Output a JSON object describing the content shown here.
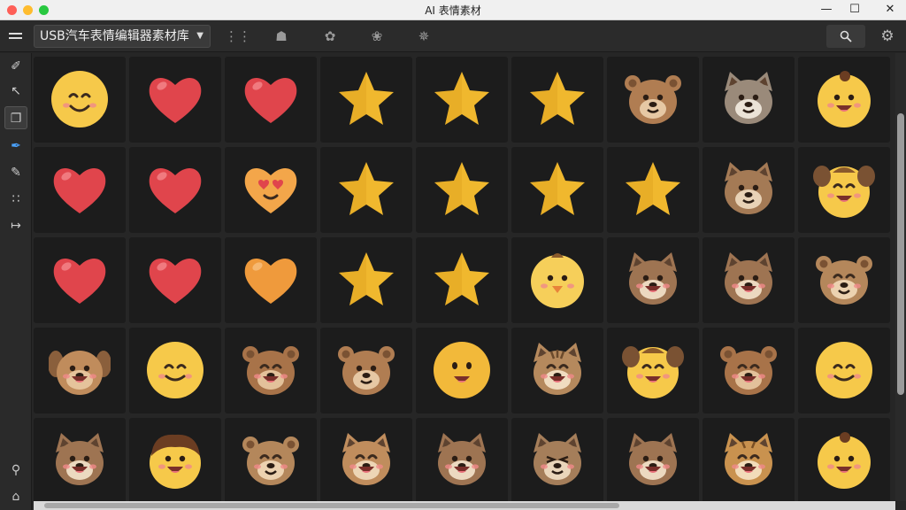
{
  "window": {
    "title": "AI 表情素材"
  },
  "toolbar": {
    "library_select": "USB汽车表情编辑器素材库",
    "tools": [
      "grid-icon",
      "bag-icon",
      "sprout-icon",
      "leaf-icon",
      "sparkle-icon"
    ],
    "search_icon": "search-icon",
    "settings_icon": "gear-icon"
  },
  "sidebar": {
    "tools": [
      "brush-icon",
      "cursor-icon",
      "new-frame-icon",
      "pen-icon",
      "pencil-icon",
      "scatter-icon",
      "crop-icon"
    ],
    "bottom": [
      "user-search-icon",
      "home-icon"
    ],
    "active_index": 2
  },
  "colors": {
    "heart": "#e0454c",
    "heart_highlight": "#f07a7f",
    "star": "#f0b82e",
    "star_shade": "#d99a1a",
    "smiley": "#f6c94a",
    "bear": "#b07d52",
    "cat": "#9a8a7a",
    "orange_heart": "#ef9a3c"
  },
  "grid": {
    "columns": 9,
    "rows": [
      [
        "smiley",
        "heart",
        "heart",
        "star",
        "star",
        "star",
        "bear",
        "wolf",
        "baby"
      ],
      [
        "heart",
        "heart",
        "heart-eyes",
        "star",
        "star",
        "star",
        "star",
        "fox",
        "puppy-smiley"
      ],
      [
        "heart",
        "heart",
        "orange-heart",
        "star",
        "star",
        "chick",
        "dog",
        "dog",
        "bear-squint"
      ],
      [
        "puppy",
        "smiley-blush",
        "bear-laugh",
        "bear",
        "smiley-open",
        "tabby",
        "puppy-smiley",
        "bear-laugh",
        "smiley-blush"
      ],
      [
        "dog",
        "boy",
        "bear-squint",
        "cat-laugh",
        "dog",
        "cat-squint",
        "dog",
        "tiger-laugh",
        "baby"
      ]
    ]
  }
}
